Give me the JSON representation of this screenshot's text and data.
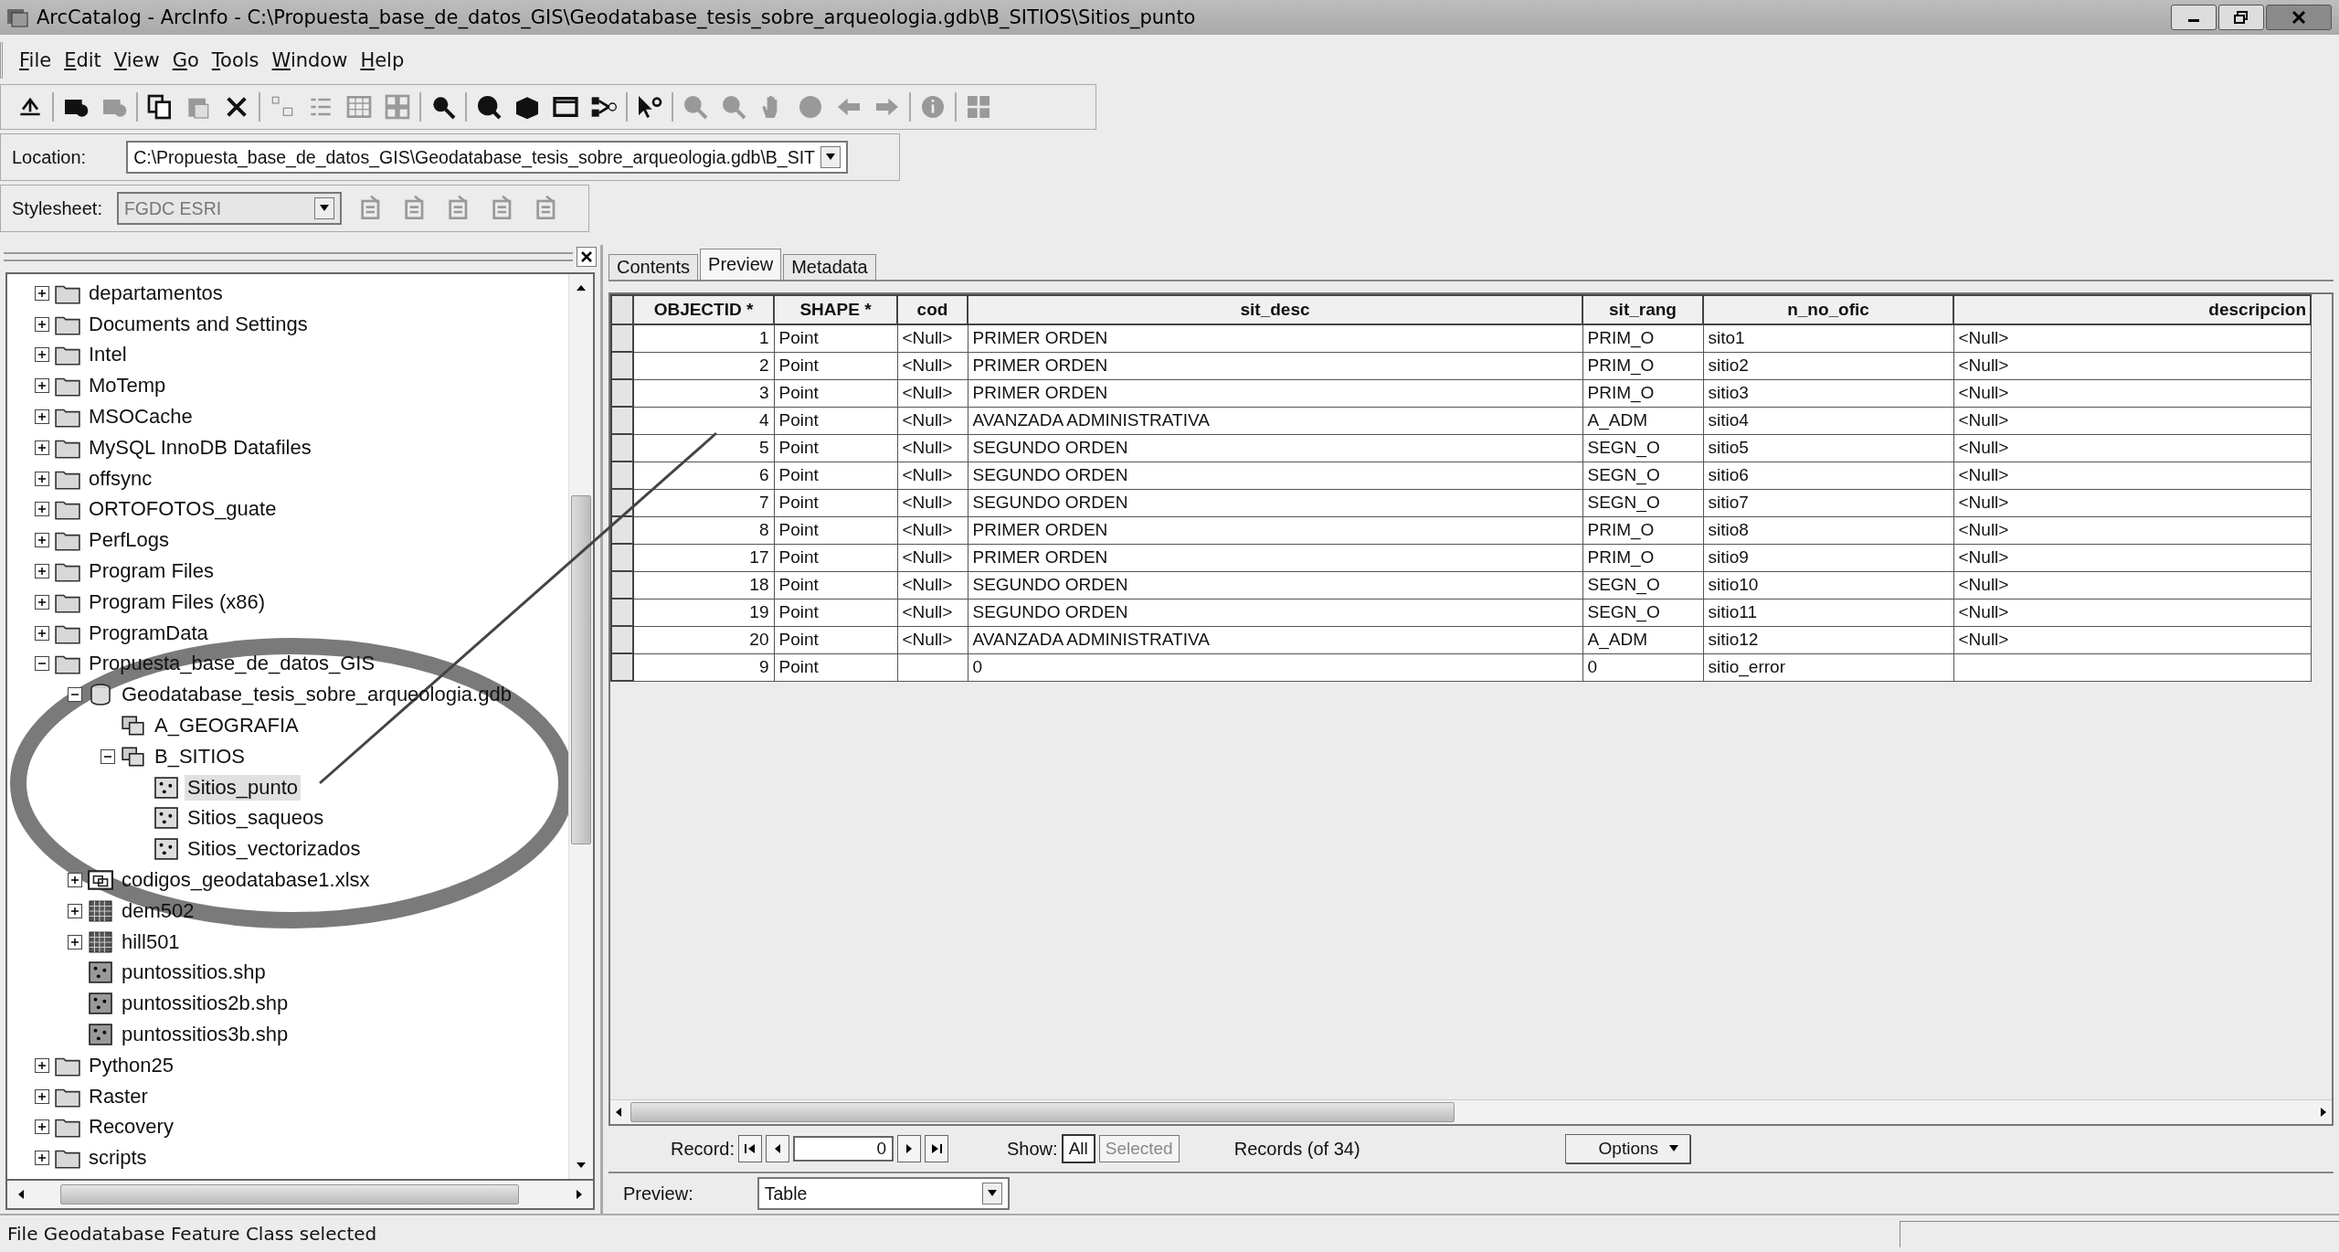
{
  "window": {
    "title": "ArcCatalog - ArcInfo - C:\\Propuesta_base_de_datos_GIS\\Geodatabase_tesis_sobre_arqueologia.gdb\\B_SITIOS\\Sitios_punto"
  },
  "menu": [
    "File",
    "Edit",
    "View",
    "Go",
    "Tools",
    "Window",
    "Help"
  ],
  "toolbar": [
    [
      {
        "disabled": false
      }
    ],
    [
      {
        "disabled": false
      },
      {
        "disabled": true
      }
    ],
    [
      {
        "disabled": false
      },
      {
        "disabled": true
      },
      {
        "disabled": false
      }
    ],
    [
      {
        "disabled": true
      },
      {
        "disabled": true
      },
      {
        "disabled": true
      },
      {
        "disabled": true
      }
    ],
    [
      {
        "disabled": false
      }
    ],
    [
      {
        "disabled": false
      },
      {
        "disabled": false
      },
      {
        "disabled": false
      },
      {
        "disabled": false
      }
    ],
    [
      {
        "disabled": false
      }
    ],
    [
      {
        "disabled": true
      },
      {
        "disabled": true
      },
      {
        "disabled": true
      },
      {
        "disabled": true
      },
      {
        "disabled": true
      },
      {
        "disabled": true
      }
    ],
    [
      {
        "disabled": true
      }
    ],
    [
      {
        "disabled": true
      }
    ]
  ],
  "location": {
    "label": "Location:",
    "value": "C:\\Propuesta_base_de_datos_GIS\\Geodatabase_tesis_sobre_arqueologia.gdb\\B_SIT"
  },
  "stylesheet": {
    "label": "Stylesheet:",
    "value": "FGDC ESRI",
    "disabled": true,
    "tools": [
      {
        "disabled": true
      },
      {
        "disabled": true
      },
      {
        "disabled": true
      },
      {
        "disabled": true
      },
      {
        "disabled": true
      }
    ]
  },
  "tree": [
    {
      "label": "departamentos",
      "kind": "folder",
      "expanded": false,
      "selected": false
    },
    {
      "label": "Documents and Settings",
      "kind": "folder",
      "expanded": false,
      "selected": false
    },
    {
      "label": "Intel",
      "kind": "folder",
      "expanded": false,
      "selected": false
    },
    {
      "label": "MoTemp",
      "kind": "folder",
      "expanded": false,
      "selected": false
    },
    {
      "label": "MSOCache",
      "kind": "folder",
      "expanded": false,
      "selected": false
    },
    {
      "label": "MySQL InnoDB Datafiles",
      "kind": "folder",
      "expanded": false,
      "selected": false
    },
    {
      "label": "offsync",
      "kind": "folder",
      "expanded": false,
      "selected": false
    },
    {
      "label": "ORTOFOTOS_guate",
      "kind": "folder",
      "expanded": false,
      "selected": false
    },
    {
      "label": "PerfLogs",
      "kind": "folder",
      "expanded": false,
      "selected": false
    },
    {
      "label": "Program Files",
      "kind": "folder",
      "expanded": false,
      "selected": false
    },
    {
      "label": "Program Files (x86)",
      "kind": "folder",
      "expanded": false,
      "selected": false
    },
    {
      "label": "ProgramData",
      "kind": "folder",
      "expanded": false,
      "selected": false
    },
    {
      "label": "Propuesta_base_de_datos_GIS",
      "kind": "folder",
      "expanded": true,
      "selected": false,
      "children": [
        {
          "label": "Geodatabase_tesis_sobre_arqueologia.gdb",
          "kind": "geodatabase",
          "expanded": true,
          "selected": false,
          "children": [
            {
              "label": "A_GEOGRAFIA",
              "kind": "dataset",
              "selected": false
            },
            {
              "label": "B_SITIOS",
              "kind": "dataset",
              "expanded": true,
              "selected": false,
              "children": [
                {
                  "label": "Sitios_punto",
                  "kind": "feature-class",
                  "selected": true
                },
                {
                  "label": "Sitios_saqueos",
                  "kind": "feature-class",
                  "selected": false
                },
                {
                  "label": "Sitios_vectorizados",
                  "kind": "feature-class",
                  "selected": false
                }
              ]
            }
          ]
        },
        {
          "label": "codigos_geodatabase1.xlsx",
          "kind": "spreadsheet",
          "expanded": false,
          "selected": false
        },
        {
          "label": "dem502",
          "kind": "raster",
          "expanded": false,
          "selected": false
        },
        {
          "label": "hill501",
          "kind": "raster",
          "expanded": false,
          "selected": false
        },
        {
          "label": "puntossitios.shp",
          "kind": "shapefile",
          "selected": false
        },
        {
          "label": "puntossitios2b.shp",
          "kind": "shapefile",
          "selected": false
        },
        {
          "label": "puntossitios3b.shp",
          "kind": "shapefile",
          "selected": false
        }
      ]
    },
    {
      "label": "Python25",
      "kind": "folder",
      "expanded": false,
      "selected": false
    },
    {
      "label": "Raster",
      "kind": "folder",
      "expanded": false,
      "selected": false
    },
    {
      "label": "Recovery",
      "kind": "folder",
      "expanded": false,
      "selected": false
    },
    {
      "label": "scripts",
      "kind": "folder",
      "expanded": false,
      "selected": false
    }
  ],
  "tabs": [
    {
      "label": "Contents",
      "selected": false
    },
    {
      "label": "Preview",
      "selected": true
    },
    {
      "label": "Metadata",
      "selected": false
    }
  ],
  "table": {
    "columns": [
      "OBJECTID *",
      "SHAPE *",
      "cod",
      "sit_desc",
      "sit_rang",
      "n_no_ofic",
      "descripcion"
    ],
    "rows": [
      [
        "1",
        "Point",
        "<Null>",
        "PRIMER ORDEN",
        "PRIM_O",
        "sito1",
        "<Null>"
      ],
      [
        "2",
        "Point",
        "<Null>",
        "PRIMER ORDEN",
        "PRIM_O",
        "sitio2",
        "<Null>"
      ],
      [
        "3",
        "Point",
        "<Null>",
        "PRIMER ORDEN",
        "PRIM_O",
        "sitio3",
        "<Null>"
      ],
      [
        "4",
        "Point",
        "<Null>",
        "AVANZADA ADMINISTRATIVA",
        "A_ADM",
        "sitio4",
        "<Null>"
      ],
      [
        "5",
        "Point",
        "<Null>",
        "SEGUNDO ORDEN",
        "SEGN_O",
        "sitio5",
        "<Null>"
      ],
      [
        "6",
        "Point",
        "<Null>",
        "SEGUNDO ORDEN",
        "SEGN_O",
        "sitio6",
        "<Null>"
      ],
      [
        "7",
        "Point",
        "<Null>",
        "SEGUNDO ORDEN",
        "SEGN_O",
        "sitio7",
        "<Null>"
      ],
      [
        "8",
        "Point",
        "<Null>",
        "PRIMER ORDEN",
        "PRIM_O",
        "sitio8",
        "<Null>"
      ],
      [
        "17",
        "Point",
        "<Null>",
        "PRIMER ORDEN",
        "PRIM_O",
        "sitio9",
        "<Null>"
      ],
      [
        "18",
        "Point",
        "<Null>",
        "SEGUNDO ORDEN",
        "SEGN_O",
        "sitio10",
        "<Null>"
      ],
      [
        "19",
        "Point",
        "<Null>",
        "SEGUNDO ORDEN",
        "SEGN_O",
        "sitio11",
        "<Null>"
      ],
      [
        "20",
        "Point",
        "<Null>",
        "AVANZADA ADMINISTRATIVA",
        "A_ADM",
        "sitio12",
        "<Null>"
      ],
      [
        "9",
        "Point",
        "",
        "0",
        "0",
        "sitio_error",
        ""
      ]
    ]
  },
  "record_bar": {
    "label": "Record:",
    "value": "0",
    "show_label": "Show:",
    "show": [
      {
        "label": "All",
        "selected": true
      },
      {
        "label": "Selected",
        "selected": false
      }
    ],
    "count": "Records (of 34)",
    "options": "Options"
  },
  "preview": {
    "label": "Preview:",
    "value": "Table"
  },
  "status_bar": "File Geodatabase Feature Class selected"
}
